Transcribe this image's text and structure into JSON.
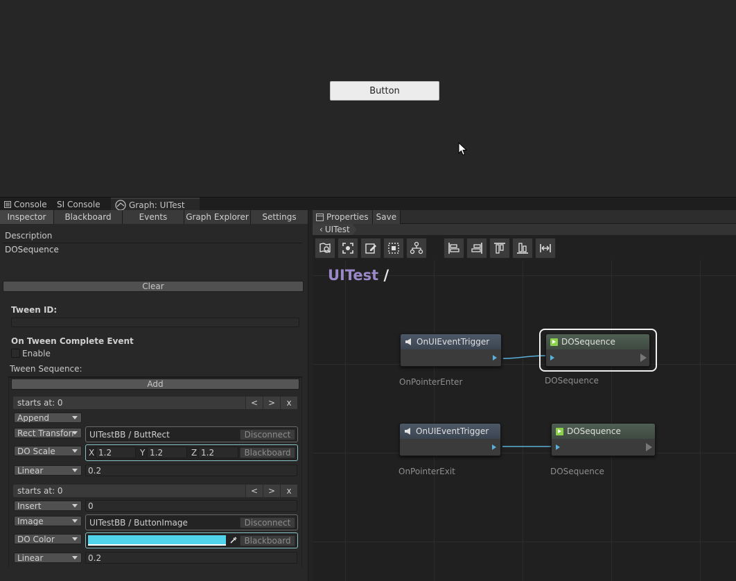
{
  "game_view": {
    "button_label": "Button"
  },
  "window_tabs": [
    {
      "label": "Console",
      "icon": "console-icon"
    },
    {
      "label": "SI Console"
    },
    {
      "label": "Graph: UITest",
      "icon": "graph-icon"
    }
  ],
  "inspector": {
    "tabs": [
      "Inspector",
      "Blackboard",
      "Events",
      "Graph Explorer",
      "Settings"
    ],
    "description_label": "Description",
    "description_value": "DOSequence",
    "clear_label": "Clear",
    "tween_id_label": "Tween ID:",
    "complete_event_label": "On Tween Complete Event",
    "enable_label": "Enable",
    "sequence_label": "Tween Sequence:",
    "add_label": "Add",
    "steps": [
      {
        "header": "starts at: 0",
        "mode": "Append",
        "target_type": "Rect Transforr",
        "target_value": "UITestBB / ButtRect",
        "disconnect_label": "Disconnect",
        "action": "DO Scale",
        "x_label": "X",
        "x_value": "1.2",
        "y_label": "Y",
        "y_value": "1.2",
        "z_label": "Z",
        "z_value": "1.2",
        "blackboard_label": "Blackboard",
        "ease": "Linear",
        "duration": "0.2"
      },
      {
        "header": "starts at: 0",
        "mode": "Insert",
        "insert_value": "0",
        "target_type": "Image",
        "target_value": "UITestBB / ButtonImage",
        "disconnect_label": "Disconnect",
        "action": "DO Color",
        "color": "#4fd4eb",
        "blackboard_label": "Blackboard",
        "ease": "Linear",
        "duration": "0.2"
      }
    ],
    "step_buttons": [
      "<",
      ">",
      "x"
    ]
  },
  "graph": {
    "top_tabs": [
      {
        "label": "Properties",
        "icon": "properties-icon"
      },
      {
        "label": "Save"
      }
    ],
    "breadcrumb": "UITest",
    "title_name": "UITest",
    "title_slash": "/",
    "toolbar_icons": [
      "frame-search-icon",
      "focus-icon",
      "edit-icon",
      "select-all-icon",
      "hierarchy-icon",
      "align-left-icon",
      "align-right-icon",
      "align-top-icon",
      "align-bottom-icon",
      "distribute-icon"
    ],
    "nodes": [
      {
        "title": "OnUIEventTrigger",
        "subtitle": "OnPointerEnter"
      },
      {
        "title": "DOSequence",
        "subtitle": "DOSequence"
      },
      {
        "title": "OnUIEventTrigger",
        "subtitle": "OnPointerExit"
      },
      {
        "title": "DOSequence",
        "subtitle": "DOSequence"
      }
    ],
    "colors": {
      "title_accent": "#9a88c8",
      "link": "#5ab0d8",
      "highlight": "#87c5c9"
    }
  }
}
